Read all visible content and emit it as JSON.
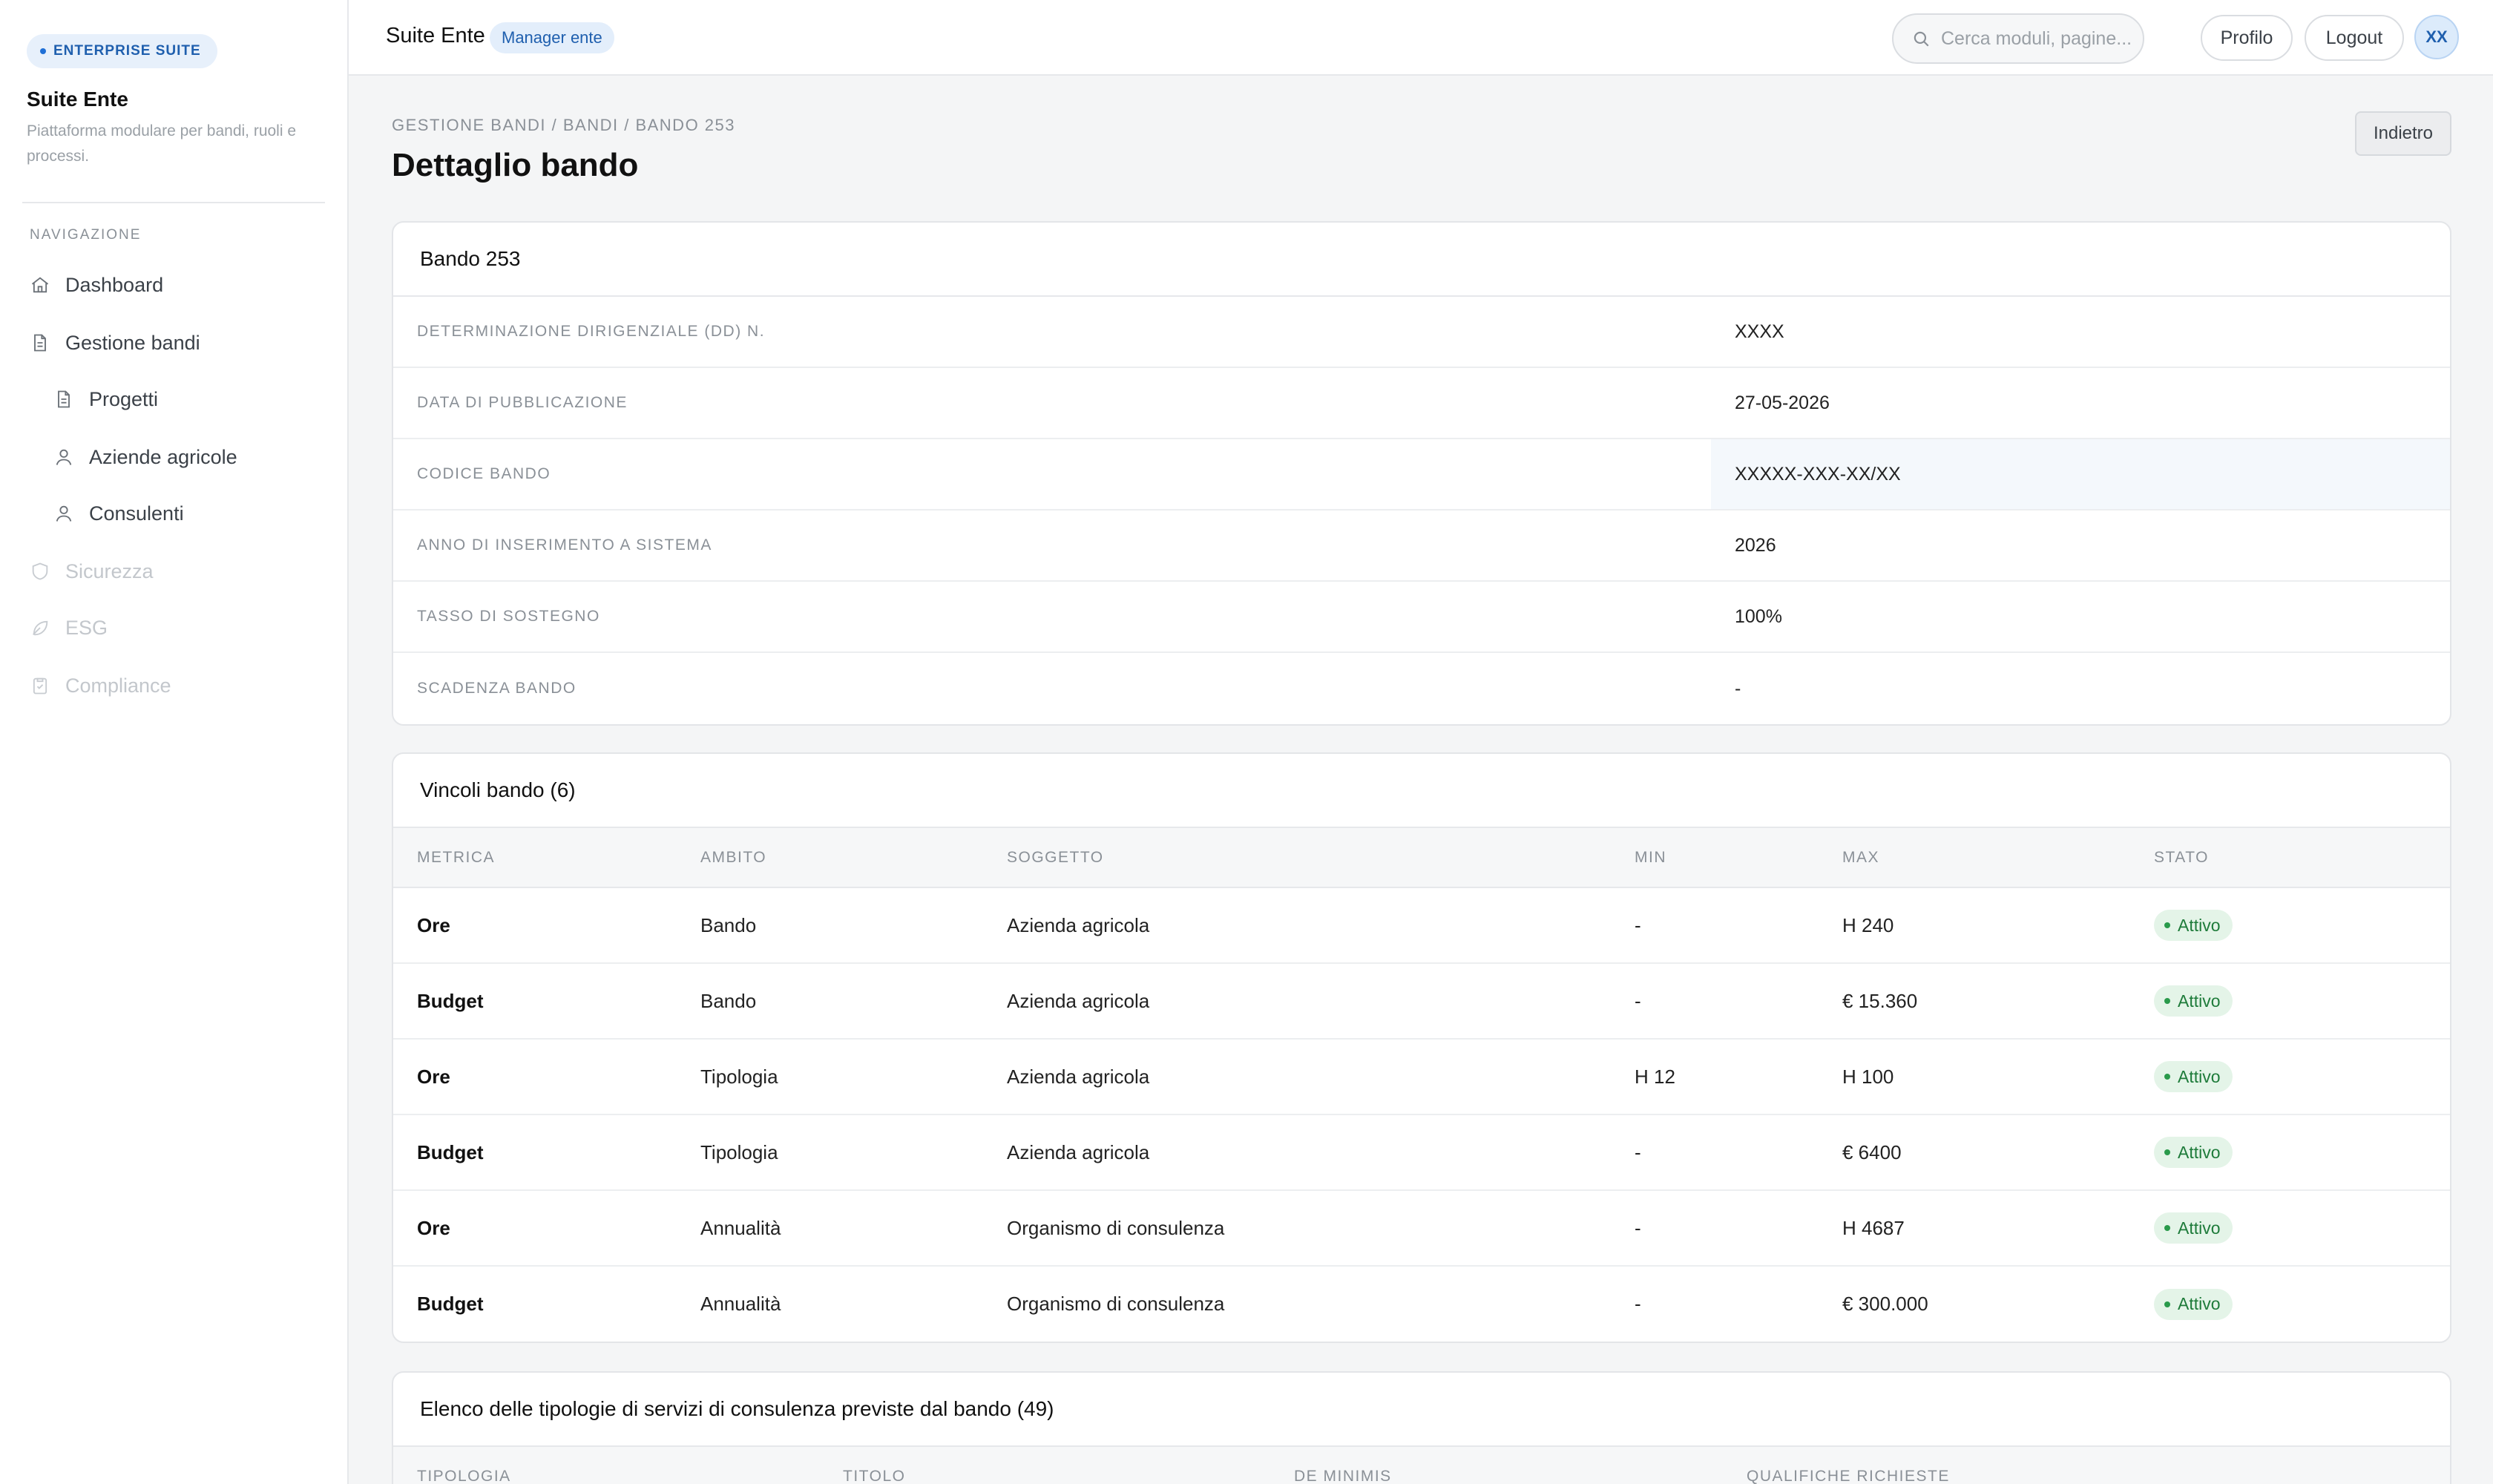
{
  "sidebar": {
    "badge": "ENTERPRISE SUITE",
    "title": "Suite Ente",
    "subtitle": "Piattaforma modulare per bandi, ruoli e processi.",
    "nav_heading": "NAVIGAZIONE",
    "items": [
      {
        "label": "Dashboard",
        "icon": "home-icon"
      },
      {
        "label": "Gestione bandi",
        "icon": "document-icon"
      },
      {
        "label": "Progetti",
        "icon": "document-icon"
      },
      {
        "label": "Aziende agricole",
        "icon": "user-icon"
      },
      {
        "label": "Consulenti",
        "icon": "user-icon"
      },
      {
        "label": "Sicurezza",
        "icon": "shield-icon"
      },
      {
        "label": "ESG",
        "icon": "leaf-icon"
      },
      {
        "label": "Compliance",
        "icon": "clipboard-check-icon"
      }
    ]
  },
  "topbar": {
    "title": "Suite Ente",
    "role": "Manager ente",
    "search_placeholder": "Cerca moduli, pagine...",
    "profile_label": "Profilo",
    "logout_label": "Logout",
    "avatar_initials": "XX"
  },
  "page": {
    "breadcrumb": "GESTIONE BANDI / BANDI / BANDO 253",
    "title": "Dettaglio bando",
    "back_label": "Indietro"
  },
  "detail_card": {
    "title": "Bando 253",
    "rows": [
      {
        "key": "DETERMINAZIONE DIRIGENZIALE (DD) N.",
        "value": "XXXX"
      },
      {
        "key": "DATA DI PUBBLICAZIONE",
        "value": "27-05-2026"
      },
      {
        "key": "CODICE BANDO",
        "value": "XXXXX-XXX-XX/XX"
      },
      {
        "key": "ANNO DI INSERIMENTO A SISTEMA",
        "value": "2026"
      },
      {
        "key": "TASSO DI SOSTEGNO",
        "value": "100%"
      },
      {
        "key": "SCADENZA BANDO",
        "value": "-"
      }
    ]
  },
  "constraints_card": {
    "title": "Vincoli bando (6)",
    "columns": [
      "METRICA",
      "AMBITO",
      "SOGGETTO",
      "MIN",
      "MAX",
      "STATO"
    ],
    "rows": [
      {
        "metric": "Ore",
        "scope": "Bando",
        "subject": "Azienda agricola",
        "min": "-",
        "max": "H 240",
        "status": "Attivo"
      },
      {
        "metric": "Budget",
        "scope": "Bando",
        "subject": "Azienda agricola",
        "min": "-",
        "max": "€ 15.360",
        "status": "Attivo"
      },
      {
        "metric": "Ore",
        "scope": "Tipologia",
        "subject": "Azienda agricola",
        "min": "H 12",
        "max": "H 100",
        "status": "Attivo"
      },
      {
        "metric": "Budget",
        "scope": "Tipologia",
        "subject": "Azienda agricola",
        "min": "-",
        "max": "€ 6400",
        "status": "Attivo"
      },
      {
        "metric": "Ore",
        "scope": "Annualità",
        "subject": "Organismo di consulenza",
        "min": "-",
        "max": "H 4687",
        "status": "Attivo"
      },
      {
        "metric": "Budget",
        "scope": "Annualità",
        "subject": "Organismo di consulenza",
        "min": "-",
        "max": "€ 300.000",
        "status": "Attivo"
      }
    ]
  },
  "services_card": {
    "title": "Elenco delle tipologie di servizi di consulenza previste dal bando (49)",
    "columns": [
      "TIPOLOGIA",
      "TITOLO",
      "DE MINIMIS",
      "QUALIFICHE RICHIESTE"
    ]
  },
  "colors": {
    "accent": "#1f6fd6",
    "status_active_bg": "#e4f4e8",
    "status_active_text": "#1e7b3a"
  }
}
